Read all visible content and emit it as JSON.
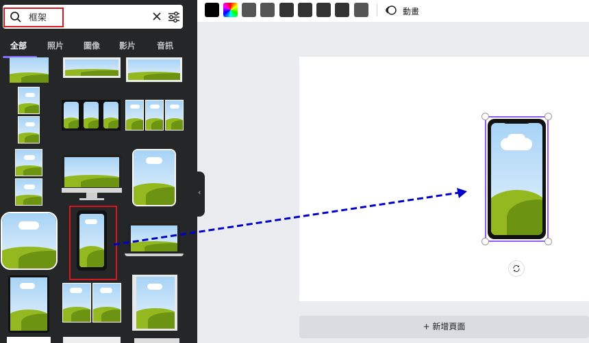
{
  "search": {
    "value": "框架",
    "placeholder": ""
  },
  "tabs": [
    {
      "label": "全部",
      "active": true
    },
    {
      "label": "照片",
      "active": false
    },
    {
      "label": "圖像",
      "active": false
    },
    {
      "label": "影片",
      "active": false
    },
    {
      "label": "音訊",
      "active": false
    }
  ],
  "toolbar": {
    "colors": [
      "#000000",
      "rainbow",
      "#555555",
      "#555555",
      "#333333",
      "#333333",
      "#333333",
      "#333333",
      "#555555"
    ],
    "animate_label": "動畫"
  },
  "canvas": {
    "add_page_label": "+ 新增頁面"
  },
  "accent_colors": {
    "selection": "#8b5cf6",
    "highlight": "#d9161d",
    "arrow": "#0000c8"
  }
}
